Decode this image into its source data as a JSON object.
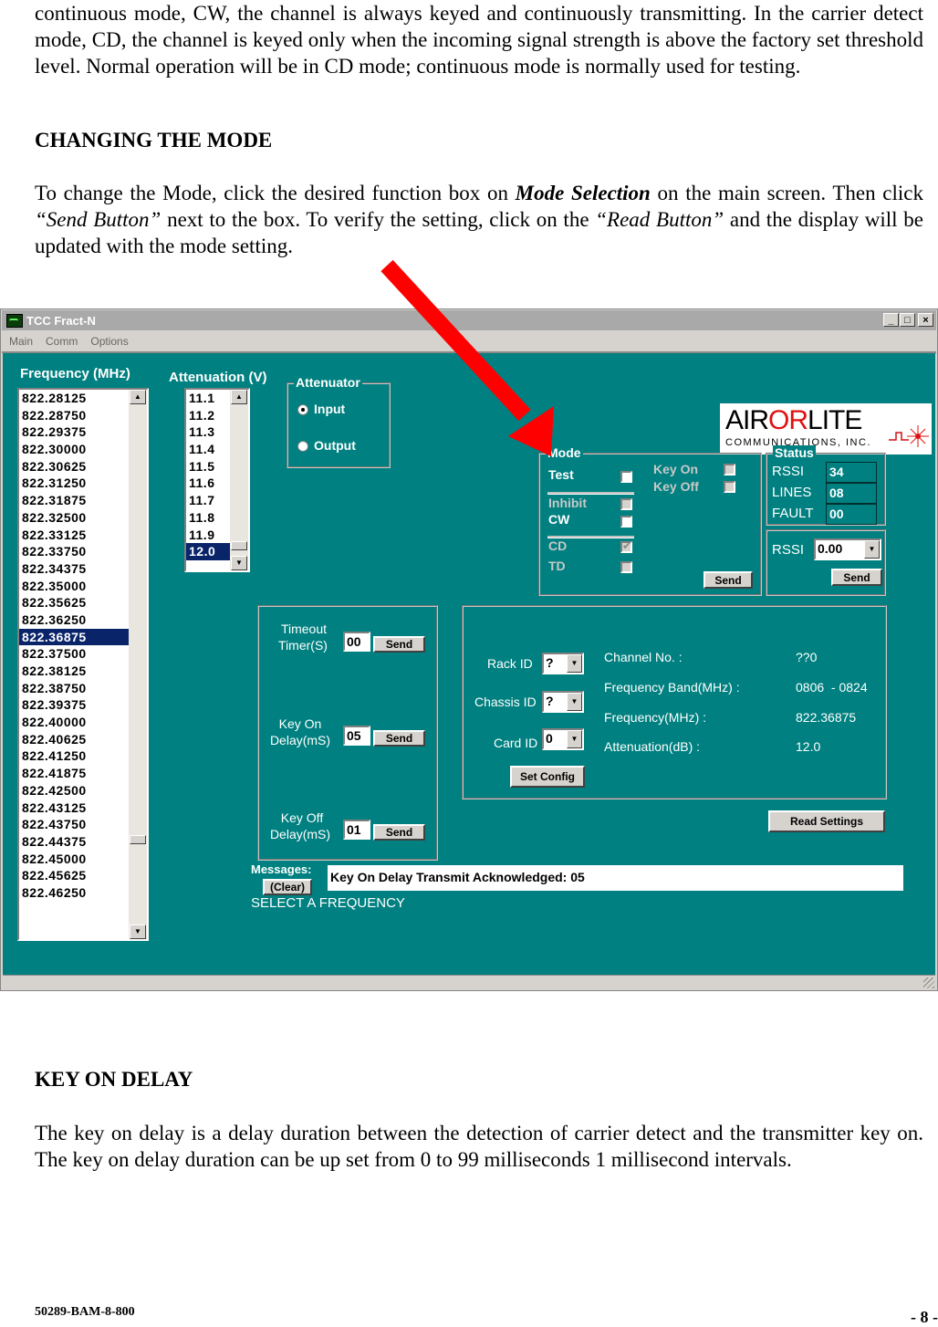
{
  "doc": {
    "para1": "continuous mode, CW, the channel is always keyed and continuously transmitting. In the carrier detect mode, CD, the channel is keyed only when the incoming signal strength is above the factory set threshold level. Normal operation will be in CD mode; continuous mode is normally used for testing.",
    "heading1": "CHANGING THE MODE",
    "para2_a": "To change the Mode, click the desired function box on ",
    "para2_b": "Mode Selection",
    "para2_c": " on the main screen. Then click ",
    "para2_d": "“Send Button”",
    "para2_e": " next to the box. To verify the setting, click on the ",
    "para2_f": "“Read Button”",
    "para2_g": " and the display will be updated with the mode setting.",
    "heading2": "KEY ON DELAY",
    "para3": "The key on delay is a delay duration between the detection of carrier detect and the transmitter key on. The key on delay duration can be up set from 0 to 99 milliseconds 1 millisecond intervals.",
    "footer_left": "50289-BAM-8-800",
    "footer_right": "- 8 -",
    "arrow_color": "#ff0000"
  },
  "window": {
    "title": "TCC Fract-N",
    "controls": {
      "minimize": "_",
      "maximize": "□",
      "close": "×"
    },
    "menu": [
      "Main",
      "Comm",
      "Options"
    ],
    "bg_color": "#008080",
    "logo": {
      "main_a": "AIR",
      "main_b": "OR",
      "main_c": "LITE",
      "sub": "COMMUNICATIONS, INC."
    },
    "frequency": {
      "label": "Frequency (MHz)",
      "items": [
        "822.28125",
        "822.28750",
        "822.29375",
        "822.30000",
        "822.30625",
        "822.31250",
        "822.31875",
        "822.32500",
        "822.33125",
        "822.33750",
        "822.34375",
        "822.35000",
        "822.35625",
        "822.36250",
        "822.36875",
        "822.37500",
        "822.38125",
        "822.38750",
        "822.39375",
        "822.40000",
        "822.40625",
        "822.41250",
        "822.41875",
        "822.42500",
        "822.43125",
        "822.43750",
        "822.44375",
        "822.45000",
        "822.45625",
        "822.46250"
      ],
      "selected": "822.36875"
    },
    "attenuation": {
      "label": "Attenuation (V)",
      "items": [
        "11.1",
        "11.2",
        "11.3",
        "11.4",
        "11.5",
        "11.6",
        "11.7",
        "11.8",
        "11.9",
        "12.0"
      ],
      "selected": "12.0"
    },
    "attenuator": {
      "legend": "Attenuator",
      "options": [
        "Input",
        "Output"
      ],
      "selected": "Input"
    },
    "mode": {
      "legend": "Mode",
      "test": "Test",
      "inhibit": "Inhibit",
      "cw": "CW",
      "cd": "CD",
      "td": "TD",
      "key_on": "Key On",
      "key_off": "Key Off",
      "cd_checked": true,
      "send": "Send"
    },
    "status": {
      "legend": "Status",
      "rows": [
        {
          "label": "RSSI",
          "value": "34"
        },
        {
          "label": "LINES",
          "value": "08"
        },
        {
          "label": "FAULT",
          "value": "00"
        }
      ]
    },
    "rssi": {
      "label": "RSSI",
      "value": "0.00",
      "send": "Send"
    },
    "timers": {
      "timeout_label_1": "Timeout",
      "timeout_label_2": "Timer(S)",
      "timeout_value": "00",
      "keyon_label_1": "Key On",
      "keyon_label_2": "Delay(mS)",
      "keyon_value": "05",
      "keyoff_label_1": "Key Off",
      "keyoff_label_2": "Delay(mS)",
      "keyoff_value": "01",
      "send": "Send"
    },
    "config": {
      "rack_label": "Rack ID",
      "rack_value": "?",
      "chassis_label": "Chassis ID",
      "chassis_value": "?",
      "card_label": "Card ID",
      "card_value": "0",
      "set_config": "Set Config",
      "info": [
        {
          "label": "Channel No. :",
          "value": "??0"
        },
        {
          "label": "Frequency Band(MHz) :",
          "value": "0806  - 0824"
        },
        {
          "label": "Frequency(MHz) :",
          "value": "822.36875"
        },
        {
          "label": "Attenuation(dB) :",
          "value": "12.0"
        }
      ]
    },
    "read_settings": "Read Settings",
    "messages": {
      "label": "Messages:",
      "clear": "(Clear)",
      "text": "Key On Delay Transmit Acknowledged: 05",
      "hint": "SELECT A FREQUENCY"
    }
  }
}
